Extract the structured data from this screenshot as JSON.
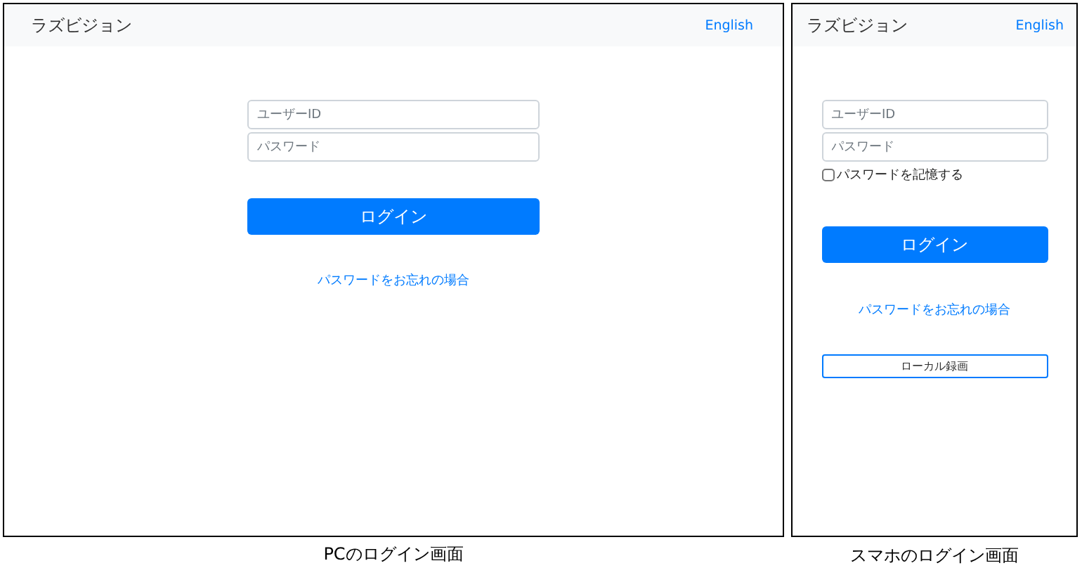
{
  "screens": [
    {
      "kind": "pc",
      "app_title": "ラズビジョン",
      "language_link": "English",
      "user_id": {
        "placeholder": "ユーザーID"
      },
      "password": {
        "placeholder": "パスワード"
      },
      "login_button": "ログイン",
      "forgot_link": "パスワードをお忘れの場合",
      "caption": "PCのログイン画面"
    },
    {
      "kind": "mobile",
      "app_title": "ラズビジョン",
      "language_link": "English",
      "user_id": {
        "placeholder": "ユーザーID"
      },
      "password": {
        "placeholder": "パスワード"
      },
      "remember": {
        "label": "パスワードを記憶する",
        "checked": false
      },
      "login_button": "ログイン",
      "forgot_link": "パスワードをお忘れの場合",
      "local_button": "ローカル録画",
      "caption": "スマホのログイン画面"
    }
  ]
}
